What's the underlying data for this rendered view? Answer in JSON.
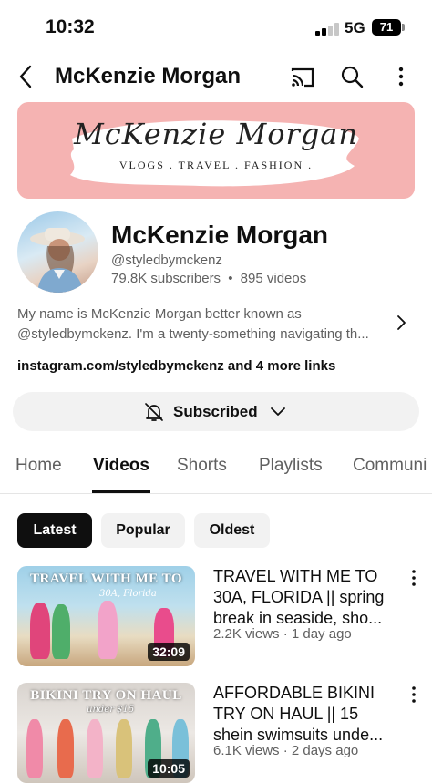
{
  "status_bar": {
    "time": "10:32",
    "network": "5G",
    "battery": "71"
  },
  "top_bar": {
    "title": "McKenzie Morgan"
  },
  "icons": {
    "back": "back-arrow-icon",
    "cast": "cast-icon",
    "search": "search-icon",
    "more": "more-vert-icon",
    "bell": "bell-off-icon",
    "chevron_right": "chevron-right-icon",
    "chevron_down": "chevron-down-icon"
  },
  "banner": {
    "script_text": "McKenzie Morgan",
    "tagline": "VLOGS . TRAVEL . FASHION ."
  },
  "channel": {
    "name": "McKenzie Morgan",
    "handle": "@styledbymckenz",
    "subscribers": "79.8K subscribers",
    "separator": "•",
    "videos": "895 videos",
    "description_line1": "My name is McKenzie Morgan better known as",
    "description_line2": "@styledbymckenz. I'm a twenty-something navigating th...",
    "links": "instagram.com/styledbymckenz and 4 more links"
  },
  "subscribe": {
    "label": "Subscribed"
  },
  "tabs": [
    "Home",
    "Videos",
    "Shorts",
    "Playlists",
    "Communi"
  ],
  "chips": [
    "Latest",
    "Popular",
    "Oldest"
  ],
  "videos": [
    {
      "thumb_title": "TRAVEL WITH ME TO",
      "thumb_sub": "30A, Florida",
      "duration": "32:09",
      "title_line1": "TRAVEL WITH ME TO",
      "title_line2": "30A, FLORIDA || spring",
      "title_line3": "break in seaside, sho...",
      "meta": "2.2K views · 1 day ago"
    },
    {
      "thumb_title": "BIKINI TRY ON HAUL",
      "thumb_sub": "under $15",
      "duration": "10:05",
      "title_line1": "AFFORDABLE BIKINI",
      "title_line2": "TRY ON HAUL || 15",
      "title_line3": "shein swimsuits unde...",
      "meta": "6.1K views · 2 days ago"
    }
  ],
  "colors": {
    "banner": "#f5b3b2",
    "chip_active": "#0f0f0f",
    "chip": "#f2f2f2",
    "secondary_text": "#606060"
  }
}
